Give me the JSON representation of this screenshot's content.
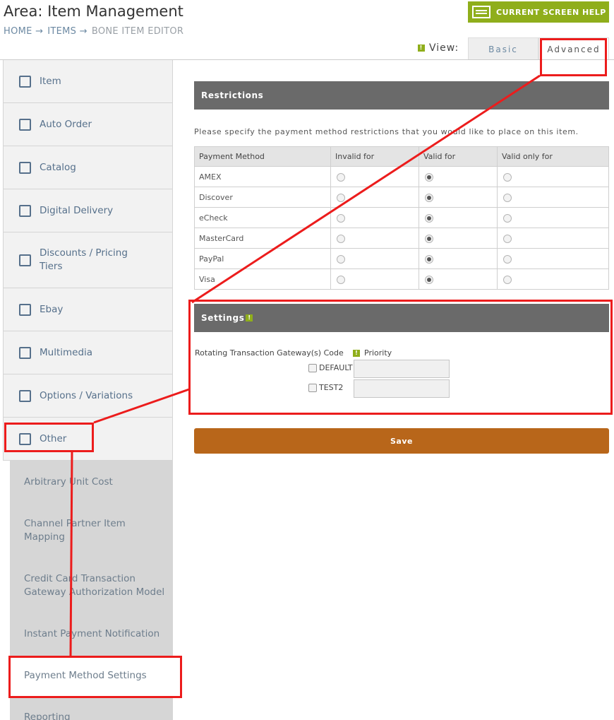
{
  "header": {
    "title": "Area: Item Management",
    "breadcrumb": [
      "HOME →",
      "ITEMS →",
      "BONE ITEM EDITOR"
    ],
    "help_button": "CURRENT SCREEN HELP",
    "view_label": "View:",
    "view_tabs": [
      "Basic",
      "Advanced"
    ]
  },
  "sidebar": {
    "items": [
      {
        "label": "Item",
        "icon": "cube-icon"
      },
      {
        "label": "Auto Order",
        "icon": "auto-order-icon"
      },
      {
        "label": "Catalog",
        "icon": "catalog-icon"
      },
      {
        "label": "Digital Delivery",
        "icon": "download-icon"
      },
      {
        "label": "Discounts / Pricing Tiers",
        "icon": "dollar-icon"
      },
      {
        "label": "Ebay",
        "icon": "bank-icon"
      },
      {
        "label": "Multimedia",
        "icon": "images-icon"
      },
      {
        "label": "Options / Variations",
        "icon": "sliders-icon"
      },
      {
        "label": "Other",
        "icon": "sliders-icon"
      }
    ],
    "sub_items": [
      "Arbitrary Unit Cost",
      "Channel Partner Item Mapping",
      "Credit Card Transaction Gateway Authorization Model",
      "Instant Payment Notification",
      "Payment Method Settings",
      "Reporting"
    ]
  },
  "restrictions": {
    "title": "Restrictions",
    "instruction": "Please specify the payment method restrictions that you would like to place on this item.",
    "columns": [
      "Payment Method",
      "Invalid for",
      "Valid for",
      "Valid only for"
    ],
    "rows": [
      {
        "method": "AMEX",
        "selected": 1
      },
      {
        "method": "Discover",
        "selected": 1
      },
      {
        "method": "eCheck",
        "selected": 1
      },
      {
        "method": "MasterCard",
        "selected": 1
      },
      {
        "method": "PayPal",
        "selected": 1
      },
      {
        "method": "Visa",
        "selected": 1
      }
    ]
  },
  "settings": {
    "title": "Settings",
    "gateway_label": "Rotating Transaction Gateway(s) Code",
    "priority_label": "Priority",
    "gateways": [
      {
        "code": "DEFAULT",
        "checked": false,
        "priority": ""
      },
      {
        "code": "TEST2",
        "checked": false,
        "priority": ""
      }
    ]
  },
  "save_button": "Save",
  "colors": {
    "accent_green": "#8fae1b",
    "save_orange": "#b8661a",
    "panel_header": "#6a6a6a",
    "annotation_red": "#ec1c1c"
  }
}
